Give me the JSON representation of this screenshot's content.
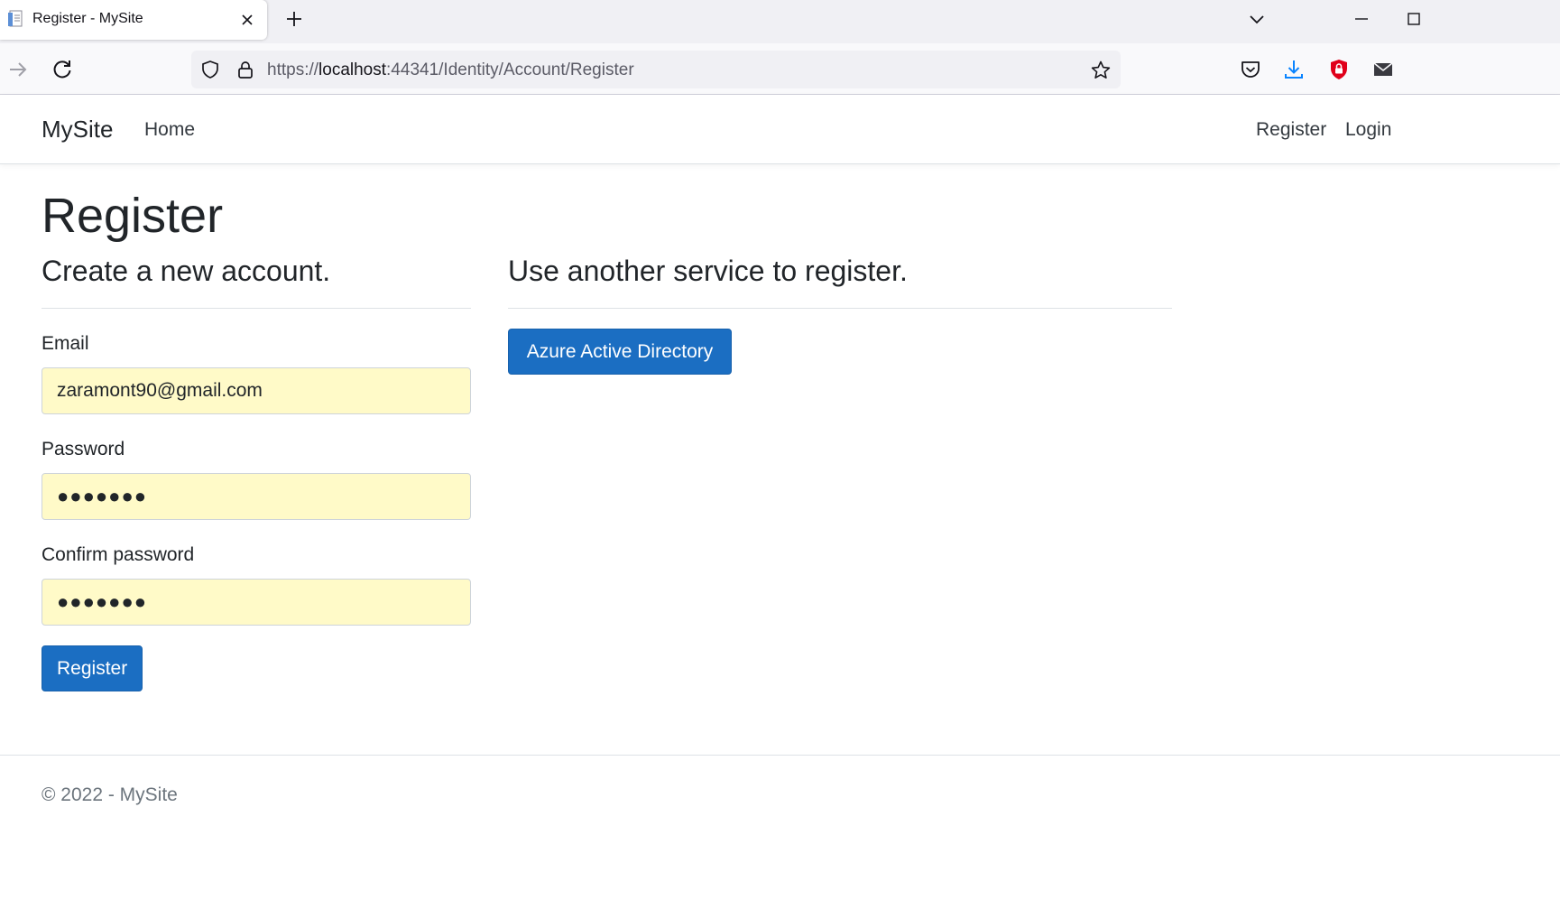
{
  "browser": {
    "tab_title": "Register - MySite",
    "url_prefix": "https://",
    "url_host": "localhost",
    "url_rest": ":44341/Identity/Account/Register"
  },
  "site": {
    "brand": "MySite",
    "nav": {
      "home": "Home",
      "register": "Register",
      "login": "Login"
    }
  },
  "page": {
    "title": "Register",
    "form_heading": "Create a new account.",
    "external_heading": "Use another service to register.",
    "email_label": "Email",
    "email_value": "zaramont90@gmail.com",
    "password_label": "Password",
    "password_value": "●●●●●●●",
    "confirm_label": "Confirm password",
    "confirm_value": "●●●●●●●",
    "register_button": "Register",
    "external_provider_button": "Azure Active Directory"
  },
  "footer": {
    "text": "© 2022 - MySite"
  },
  "colors": {
    "primary": "#1b6ec2",
    "autofill": "#fffac8",
    "shield_red": "#e0001a",
    "download_blue": "#0a84ff"
  }
}
